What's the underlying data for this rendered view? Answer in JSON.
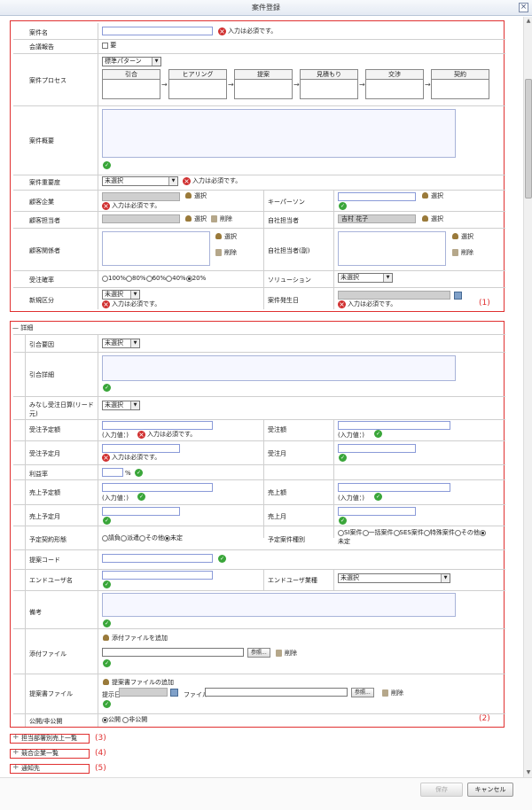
{
  "title": "案件登録",
  "required": "入力は必須です。",
  "select_btn": "選択",
  "delete_btn": "削除",
  "unselected": "未選択",
  "annotations": [
    "(1)",
    "(2)",
    "(3)",
    "(4)",
    "(5)"
  ],
  "s1": {
    "case_name": "案件名",
    "meeting": "会議報告",
    "meeting_opt": "要",
    "process": "案件プロセス",
    "process_select": "標準パターン",
    "stages": [
      "引合",
      "ヒアリング",
      "提案",
      "見積もり",
      "交渉",
      "契約"
    ],
    "overview": "案件概要",
    "importance": "案件重要度",
    "customer": "顧客企業",
    "key_person": "キーパーソン",
    "customer_contact": "顧客担当者",
    "own_contact": "自社担当者",
    "own_contact_value": "吉村 花子",
    "customer_related": "顧客関係者",
    "own_contact_sub": "自社担当者(副)",
    "probability": "受注確率",
    "prob_opts": [
      "100%",
      "80%",
      "60%",
      "40%",
      "20%"
    ],
    "solution": "ソリューション",
    "new_type": "新規区分",
    "occur_date": "案件発生日"
  },
  "s2": {
    "header": "詳細",
    "inquiry_reason": "引合要因",
    "inquiry_detail": "引合詳細",
    "deemed_date": "みなし受注日算(リード元)",
    "expected_amount": "受注予定額",
    "actual_amount": "受注額",
    "input_value": "(入力値：)",
    "expected_month": "受注予定月",
    "actual_month": "受注月",
    "profit": "利益率",
    "pct": "%",
    "sales_expected": "売上予定額",
    "sales": "売上額",
    "sales_expected_month": "売上予定月",
    "sales_month": "売上月",
    "contract_type": "予定契約形態",
    "contract_opts": [
      "請負",
      "派遣",
      "その他",
      "未定"
    ],
    "case_type": "予定案件種別",
    "case_opts": [
      "SI案件",
      "一括案件",
      "SES案件",
      "特殊案件",
      "その他",
      "未定"
    ],
    "proposal_code": "提案コード",
    "end_user": "エンドユーザ名",
    "end_user_industry": "エンドユーザ業種",
    "notes": "備考",
    "attachment": "添付ファイル",
    "add_attachment": "添付ファイルを追加",
    "browse": "参照...",
    "proposal_file": "提案書ファイル",
    "add_proposal": "提案書ファイルの追加",
    "submit_date": "提示日",
    "file": "ファイル",
    "visibility": "公開/非公開",
    "public": "公開",
    "private": "非公開"
  },
  "sections": [
    "担当部署別売上一覧",
    "競合企業一覧",
    "通知先"
  ],
  "footer": {
    "save": "保存",
    "cancel": "キャンセル"
  }
}
